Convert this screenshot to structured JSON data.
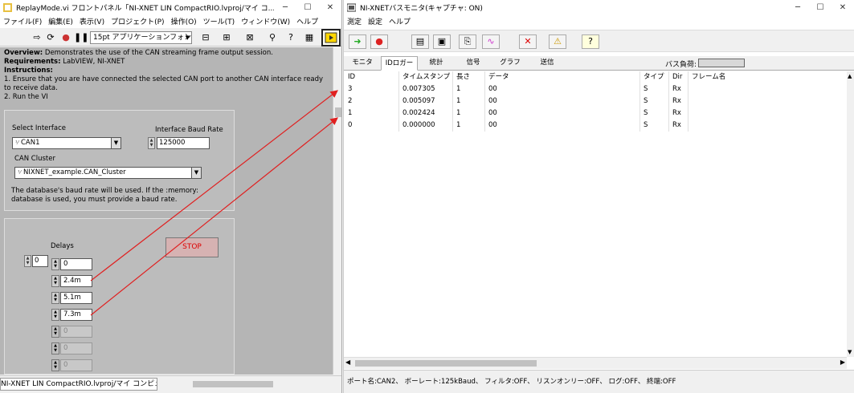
{
  "labview": {
    "title": "ReplayMode.vi フロントパネル「NI-XNET LIN CompactRIO.lvproj/マイ コ...",
    "menu": [
      "ファイル(F)",
      "編集(E)",
      "表示(V)",
      "プロジェクト(P)",
      "操作(O)",
      "ツール(T)",
      "ウィンドウ(W)",
      "ヘルプ"
    ],
    "font_select": "15pt アプリケーションフォント",
    "overview_label": "Overview:",
    "overview_text": " Demonstrates the use of the CAN streaming frame output session.",
    "requirements_label": "Requirements:",
    "requirements_text": " LabVIEW, NI-XNET",
    "instructions_label": "Instructions:",
    "instruction_1": "1. Ensure that you are have connected the selected CAN port to another CAN interface ready to receive data.",
    "instruction_2": "2. Run the VI",
    "select_interface_label": "Select Interface",
    "interface_value": "CAN1",
    "baud_rate_label": "Interface Baud Rate",
    "baud_rate_value": "125000",
    "cluster_label": "CAN Cluster",
    "cluster_value": "NIXNET_example.CAN_Cluster",
    "baud_note": "The database's baud rate will be used.  If the :memory: database is used, you must provide a baud rate.",
    "delays_label": "Delays",
    "index_value": "0",
    "delays": [
      "0",
      "2.4m",
      "5.1m",
      "7.3m",
      "0",
      "0",
      "0"
    ],
    "stop_label": "STOP",
    "status_project": "NI-XNET LIN CompactRIO.lvproj/マイ コンピュータ"
  },
  "monitor": {
    "title": "NI-XNETバスモニタ(キャプチャ: ON)",
    "menu": [
      "測定",
      "設定",
      "ヘルプ"
    ],
    "tabs": [
      "モニタ",
      "IDロガー",
      "統計",
      "信号",
      "グラフ",
      "送信"
    ],
    "active_tab": 1,
    "bus_load_label": "バス負荷:",
    "columns": [
      "ID",
      "タイムスタンプ",
      "長さ",
      "データ",
      "タイプ",
      "Dir",
      "フレーム名"
    ],
    "rows": [
      [
        "3",
        "0.007305",
        "1",
        "00",
        "S",
        "Rx",
        ""
      ],
      [
        "2",
        "0.005097",
        "1",
        "00",
        "S",
        "Rx",
        ""
      ],
      [
        "1",
        "0.002424",
        "1",
        "00",
        "S",
        "Rx",
        ""
      ],
      [
        "0",
        "0.000000",
        "1",
        "00",
        "S",
        "Rx",
        ""
      ]
    ],
    "status": "ポート名:CAN2、 ボーレート:125kBaud、 フィルタ:OFF、 リスンオンリー:OFF、 ログ:OFF、 終端:OFF"
  },
  "colors": {
    "annotation_arrow": "#e02020",
    "panel_bg": "#b5b5b5",
    "stop_text": "#dd0000"
  }
}
